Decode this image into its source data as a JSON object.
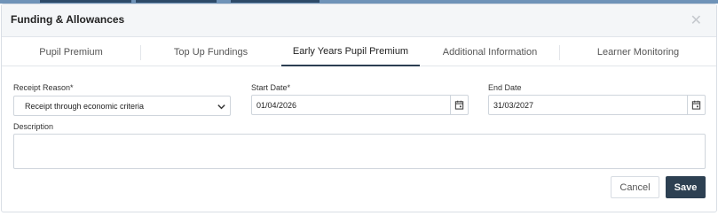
{
  "dialog": {
    "title": "Funding & Allowances",
    "close_icon": "close-icon"
  },
  "tabs": [
    {
      "label": "Pupil Premium",
      "active": false
    },
    {
      "label": "Top Up Fundings",
      "active": false
    },
    {
      "label": "Early Years Pupil Premium",
      "active": true
    },
    {
      "label": "Additional Information",
      "active": false
    },
    {
      "label": "Learner Monitoring",
      "active": false
    }
  ],
  "form": {
    "receipt_reason": {
      "label": "Receipt Reason*",
      "value": "Receipt through economic criteria"
    },
    "start_date": {
      "label": "Start Date*",
      "value": "01/04/2026"
    },
    "end_date": {
      "label": "End Date",
      "value": "31/03/2027"
    },
    "description": {
      "label": "Description",
      "value": ""
    }
  },
  "buttons": {
    "cancel": "Cancel",
    "save": "Save"
  },
  "colors": {
    "primary": "#2d4052",
    "tab_active_underline": "#2b3e52",
    "border": "#cfd5dc"
  }
}
